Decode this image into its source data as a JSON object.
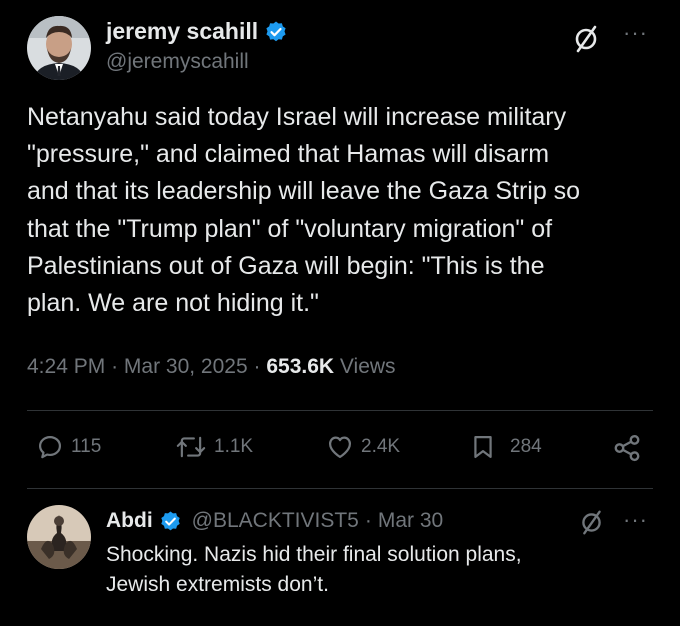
{
  "tweet": {
    "author_name": "jeremy scahill",
    "author_handle": "@jeremyscahill",
    "text": "Netanyahu said today Israel will increase military\n\"pressure,\" and claimed that Hamas will disarm\nand that its leadership will leave the Gaza Strip so\nthat the \"Trump plan\" of \"voluntary migration\" of\nPalestinians out of Gaza will begin: \"This is the\nplan. We are not hiding it.\"",
    "time": "4:24 PM",
    "date": "Mar 30, 2025",
    "views_count": "653.6K",
    "views_label": "Views",
    "replies": "115",
    "reposts": "1.1K",
    "likes": "2.4K",
    "bookmarks": "284",
    "more_glyph": "···",
    "dot": "·"
  },
  "reply": {
    "author_name": "Abdi",
    "author_handle": "@BLACKTIVIST5",
    "date": "Mar 30",
    "text": "Shocking. Nazis hid their final solution plans,\nJewish extremists  don’t.",
    "more_glyph": "···",
    "dot": "·"
  },
  "colors": {
    "background": "#000000",
    "text": "#e7e9ea",
    "secondary": "#71767b",
    "verified": "#1d9bf0"
  }
}
